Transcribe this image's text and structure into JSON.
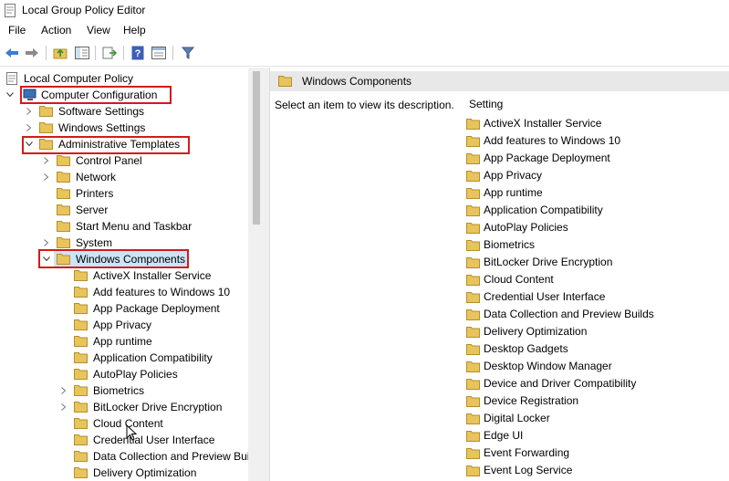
{
  "window": {
    "title": "Local Group Policy Editor"
  },
  "menu": [
    "File",
    "Action",
    "View",
    "Help"
  ],
  "toolbar": [
    "back-icon",
    "forward-icon",
    "up-folder-icon",
    "show-hide-tree-icon",
    "export-list-icon",
    "help-icon",
    "properties-icon",
    "filter-icon"
  ],
  "tree": {
    "root": "Local Computer Policy",
    "computer_configuration": "Computer Configuration",
    "software_settings": "Software Settings",
    "windows_settings": "Windows Settings",
    "administrative_templates": "Administrative Templates",
    "control_panel": "Control Panel",
    "network": "Network",
    "printers": "Printers",
    "server": "Server",
    "start_menu": "Start Menu and Taskbar",
    "system": "System",
    "windows_components": "Windows Components",
    "children": [
      "ActiveX Installer Service",
      "Add features to Windows 10",
      "App Package Deployment",
      "App Privacy",
      "App runtime",
      "Application Compatibility",
      "AutoPlay Policies",
      "Biometrics",
      "BitLocker Drive Encryption",
      "Cloud Content",
      "Credential User Interface",
      "Data Collection and Preview Builds",
      "Delivery Optimization"
    ]
  },
  "details": {
    "header": "Windows Components",
    "description": "Select an item to view its description.",
    "column_header": "Setting",
    "items": [
      "ActiveX Installer Service",
      "Add features to Windows 10",
      "App Package Deployment",
      "App Privacy",
      "App runtime",
      "Application Compatibility",
      "AutoPlay Policies",
      "Biometrics",
      "BitLocker Drive Encryption",
      "Cloud Content",
      "Credential User Interface",
      "Data Collection and Preview Builds",
      "Delivery Optimization",
      "Desktop Gadgets",
      "Desktop Window Manager",
      "Device and Driver Compatibility",
      "Device Registration",
      "Digital Locker",
      "Edge UI",
      "Event Forwarding",
      "Event Log Service"
    ]
  },
  "colors": {
    "highlight_box": "#d11b1b",
    "selection": "#cce4f7",
    "folder": "#e8c45c"
  }
}
